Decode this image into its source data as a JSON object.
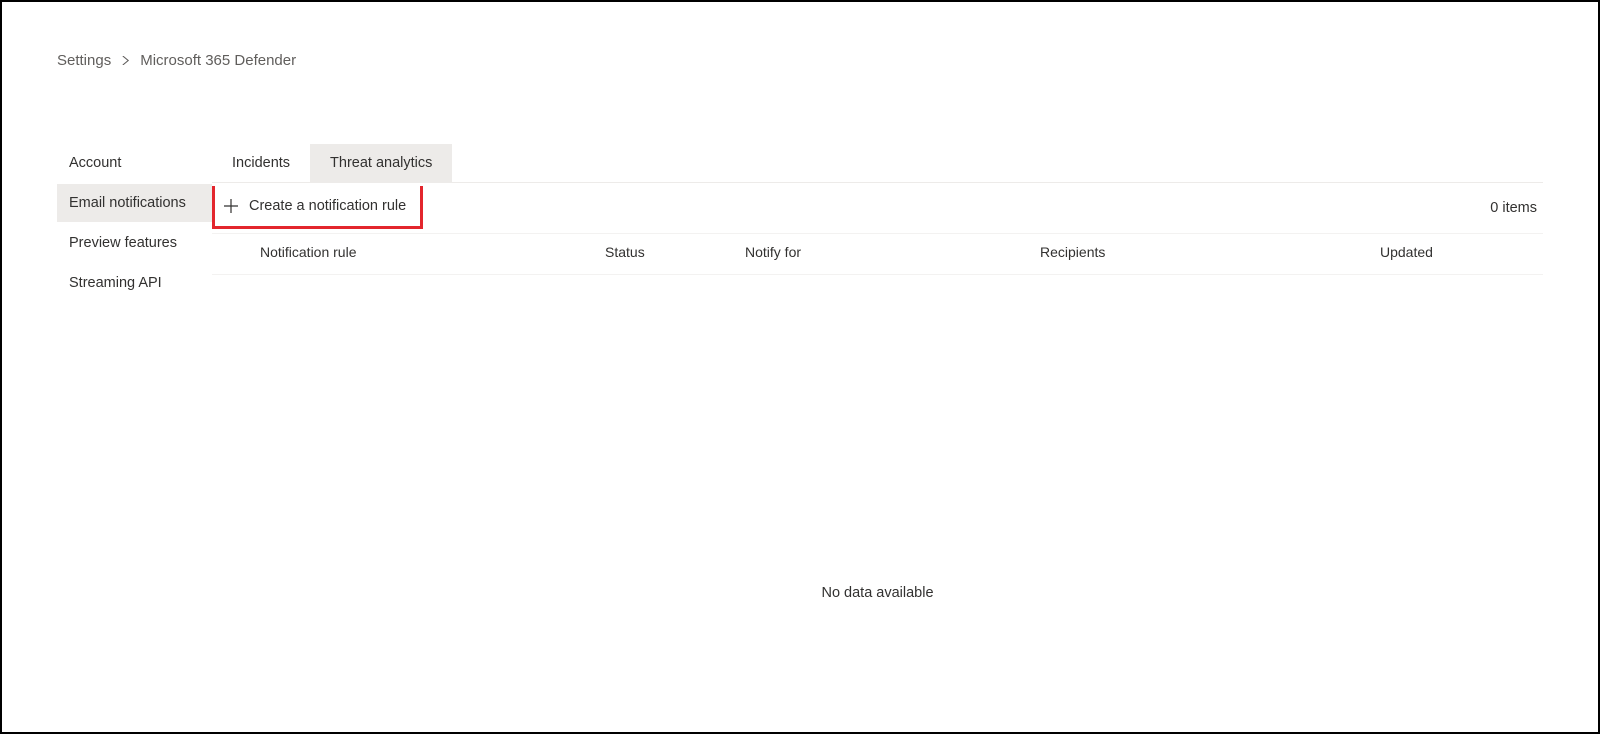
{
  "breadcrumb": {
    "root": "Settings",
    "current": "Microsoft 365 Defender"
  },
  "sidebar": {
    "items": [
      {
        "label": "Account",
        "selected": false
      },
      {
        "label": "Email notifications",
        "selected": true
      },
      {
        "label": "Preview features",
        "selected": false
      },
      {
        "label": "Streaming API",
        "selected": false
      }
    ]
  },
  "tabs": [
    {
      "label": "Incidents",
      "selected": false
    },
    {
      "label": "Threat analytics",
      "selected": true
    }
  ],
  "toolbar": {
    "create_label": "Create a notification rule",
    "item_count": "0 items"
  },
  "table": {
    "columns": {
      "notification_rule": "Notification rule",
      "status": "Status",
      "notify_for": "Notify for",
      "recipients": "Recipients",
      "updated": "Updated"
    },
    "empty_message": "No data available"
  }
}
